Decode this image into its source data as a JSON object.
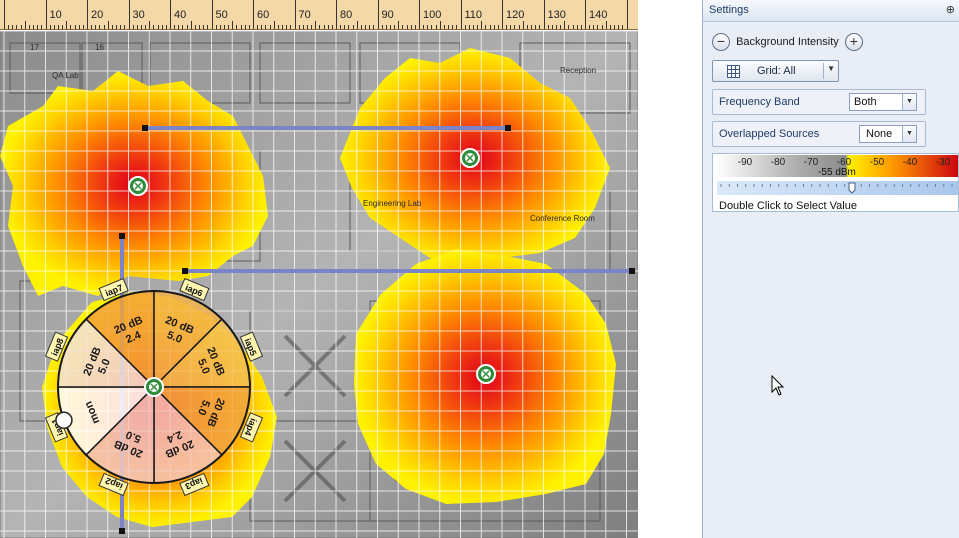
{
  "ruler": {
    "labels": [
      "10",
      "20",
      "30",
      "40",
      "50",
      "60",
      "70",
      "80",
      "90",
      "100",
      "110",
      "120",
      "130",
      "140"
    ]
  },
  "floorplan": {
    "rooms": [
      "QA Lab",
      "Reception",
      "Engineering Lab",
      "Conference Room"
    ],
    "room_numbers": [
      "17",
      "16"
    ]
  },
  "access_points": [
    "iap7",
    "iap6",
    "iap5",
    "iap4",
    "iap3",
    "iap2",
    "iap1",
    "iap8"
  ],
  "radio_wheel": {
    "sectors": [
      {
        "power": "20 dB",
        "band": "2.4"
      },
      {
        "power": "20 dB",
        "band": "5.0"
      },
      {
        "power": "20 dB",
        "band": "5.0"
      },
      {
        "power": "20 dB",
        "band": "5.0"
      },
      {
        "power": "20 dB",
        "band": "2.4"
      },
      {
        "power": "20 dB",
        "band": "5.0"
      },
      {
        "power": "mon",
        "band": ""
      },
      {
        "power": "20 dB",
        "band": "5.0"
      }
    ]
  },
  "settings": {
    "title": "Settings",
    "pin_icon": "pin-icon",
    "background_intensity": "Background Intensity",
    "grid_label": "Grid: All",
    "frequency_band": {
      "label": "Frequency Band",
      "value": "Both"
    },
    "overlapped_sources": {
      "label": "Overlapped Sources",
      "value": "None"
    },
    "legend": {
      "ticks": [
        "-90",
        "-80",
        "-70",
        "-60",
        "-50",
        "-40",
        "-30"
      ],
      "current": "-55 dBm",
      "hint": "Double Click to Select Value"
    }
  },
  "colors": {
    "heat_red": "#e0001a",
    "heat_orange": "#ff8a00",
    "heat_yellow": "#ffee00",
    "ap_marker": "#2e8b3a",
    "wall_line": "#7c84c8"
  }
}
